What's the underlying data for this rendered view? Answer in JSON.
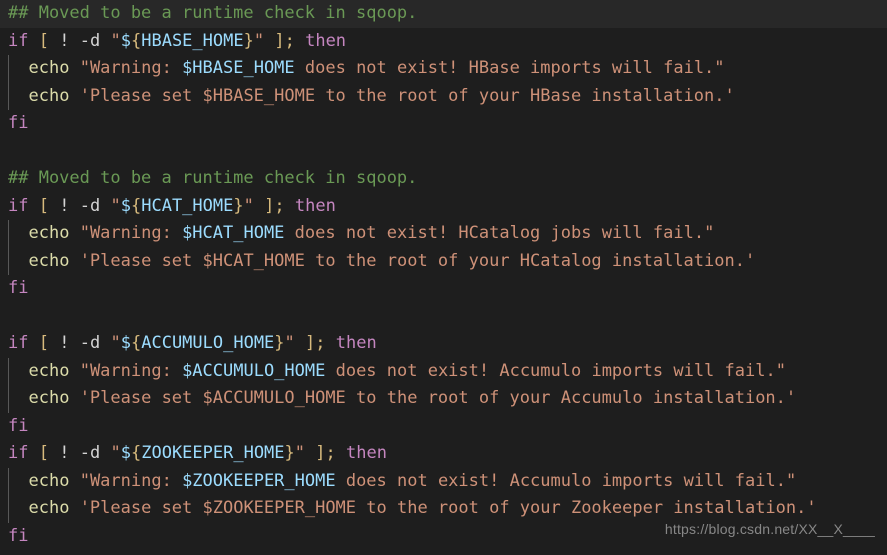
{
  "editor": {
    "language": "shellscript",
    "background_color": "#1e1e1e",
    "current_line_highlight_color": "#282828",
    "indent_guide_color": "#585858",
    "colors": {
      "comment": "#6A9955",
      "keyword": "#C586C0",
      "builtin": "#DCDCAA",
      "punctuation": "#D7BA7D",
      "plain": "#D4D4D4",
      "string": "#CE9178",
      "variable": "#9CDCFE"
    }
  },
  "lines": [
    {
      "n": 1,
      "current": true,
      "guide": false,
      "text": "## Moved to be a runtime check in sqoop."
    },
    {
      "n": 2,
      "current": false,
      "guide": false,
      "text": "if [ ! -d \"${HBASE_HOME}\" ]; then"
    },
    {
      "n": 3,
      "current": false,
      "guide": true,
      "text": "  echo \"Warning: $HBASE_HOME does not exist! HBase imports will fail.\""
    },
    {
      "n": 4,
      "current": false,
      "guide": true,
      "text": "  echo 'Please set $HBASE_HOME to the root of your HBase installation.'"
    },
    {
      "n": 5,
      "current": false,
      "guide": false,
      "text": "fi"
    },
    {
      "n": 6,
      "current": false,
      "guide": false,
      "text": ""
    },
    {
      "n": 7,
      "current": false,
      "guide": false,
      "text": "## Moved to be a runtime check in sqoop."
    },
    {
      "n": 8,
      "current": false,
      "guide": false,
      "text": "if [ ! -d \"${HCAT_HOME}\" ]; then"
    },
    {
      "n": 9,
      "current": false,
      "guide": true,
      "text": "  echo \"Warning: $HCAT_HOME does not exist! HCatalog jobs will fail.\""
    },
    {
      "n": 10,
      "current": false,
      "guide": true,
      "text": "  echo 'Please set $HCAT_HOME to the root of your HCatalog installation.'"
    },
    {
      "n": 11,
      "current": false,
      "guide": false,
      "text": "fi"
    },
    {
      "n": 12,
      "current": false,
      "guide": false,
      "text": ""
    },
    {
      "n": 13,
      "current": false,
      "guide": false,
      "text": "if [ ! -d \"${ACCUMULO_HOME}\" ]; then"
    },
    {
      "n": 14,
      "current": false,
      "guide": true,
      "text": "  echo \"Warning: $ACCUMULO_HOME does not exist! Accumulo imports will fail.\""
    },
    {
      "n": 15,
      "current": false,
      "guide": true,
      "text": "  echo 'Please set $ACCUMULO_HOME to the root of your Accumulo installation.'"
    },
    {
      "n": 16,
      "current": false,
      "guide": false,
      "text": "fi"
    },
    {
      "n": 17,
      "current": false,
      "guide": false,
      "text": "if [ ! -d \"${ZOOKEEPER_HOME}\" ]; then"
    },
    {
      "n": 18,
      "current": false,
      "guide": true,
      "text": "  echo \"Warning: $ZOOKEEPER_HOME does not exist! Accumulo imports will fail.\""
    },
    {
      "n": 19,
      "current": false,
      "guide": true,
      "text": "  echo 'Please set $ZOOKEEPER_HOME to the root of your Zookeeper installation.'"
    },
    {
      "n": 20,
      "current": false,
      "guide": false,
      "text": "fi"
    }
  ],
  "watermark": {
    "text": "https://blog.csdn.net/XX__X____"
  }
}
